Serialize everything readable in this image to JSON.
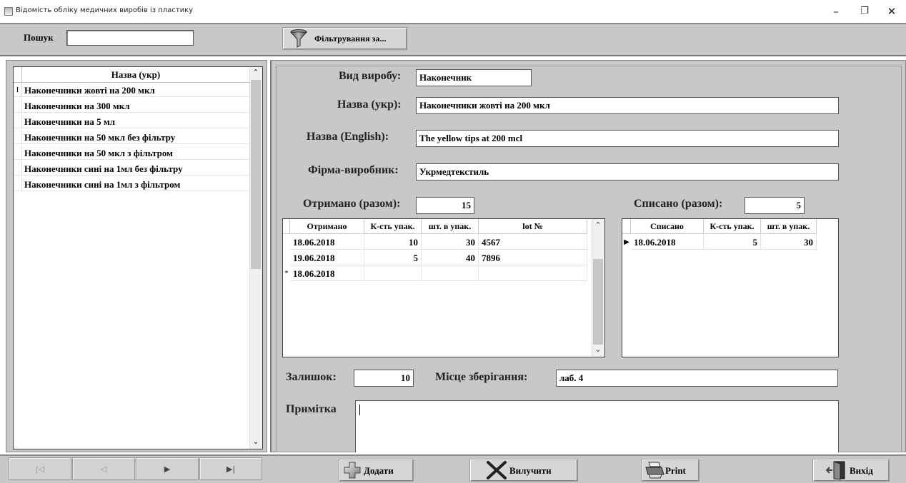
{
  "window": {
    "title": "Відомість обліку медичних виробів із пластику",
    "minimize": "–",
    "maximize": "❐",
    "close": "✕"
  },
  "toolbar": {
    "search_label": "Пошук",
    "search_value": "",
    "filter_label": "Фільтрування за..."
  },
  "list": {
    "header": "Назва (укр)",
    "current_marker": "I",
    "items": [
      "Наконечники жовті на 200 мкл",
      "Наконечники на 300 мкл",
      "Наконечники на 5 мл",
      "Наконечники на 50 мкл без фільтру",
      "Наконечники на 50 мкл з фільтром",
      "Наконечники сині на 1мл без фільтру",
      "Наконечники сині на 1мл з фільтром"
    ]
  },
  "form": {
    "kind_label": "Вид виробу:",
    "kind_value": "Наконечник",
    "name_ukr_label": "Назва (укр):",
    "name_ukr_value": "Наконечники жовті на 200 мкл",
    "name_en_label": "Назва (English):",
    "name_en_value": "The yellow tips at 200 mcl",
    "maker_label": "Фірма-виробник:",
    "maker_value": "Укрмедтекстиль",
    "received_label": "Отримано (разом):",
    "received_value": "15",
    "written_label": "Списано (разом):",
    "written_value": "5",
    "balance_label": "Залишок:",
    "balance_value": "10",
    "storage_label": "Місце зберігання:",
    "storage_value": "лаб. 4",
    "note_label": "Примітка",
    "note_value": ""
  },
  "received_grid": {
    "headers": [
      "Отримано",
      "К-сть упак.",
      "шт. в упак.",
      "lot №"
    ],
    "rows": [
      [
        "18.06.2018",
        "10",
        "30",
        "4567"
      ],
      [
        "19.06.2018",
        "5",
        "40",
        "7896"
      ],
      [
        "18.06.2018",
        "",
        "",
        ""
      ]
    ],
    "new_row_marker": "*"
  },
  "written_grid": {
    "headers": [
      "Списано",
      "К-сть упак.",
      "шт. в упак."
    ],
    "rows": [
      [
        "18.06.2018",
        "5",
        "30"
      ]
    ],
    "current_marker": "▶"
  },
  "bottom": {
    "nav_first": "|◁",
    "nav_prev": "◁",
    "nav_next": "▶",
    "nav_last": "▶|",
    "add_label": "Додати",
    "delete_label": "Вилучити",
    "print_label": "Print",
    "exit_label": "Вихід"
  }
}
